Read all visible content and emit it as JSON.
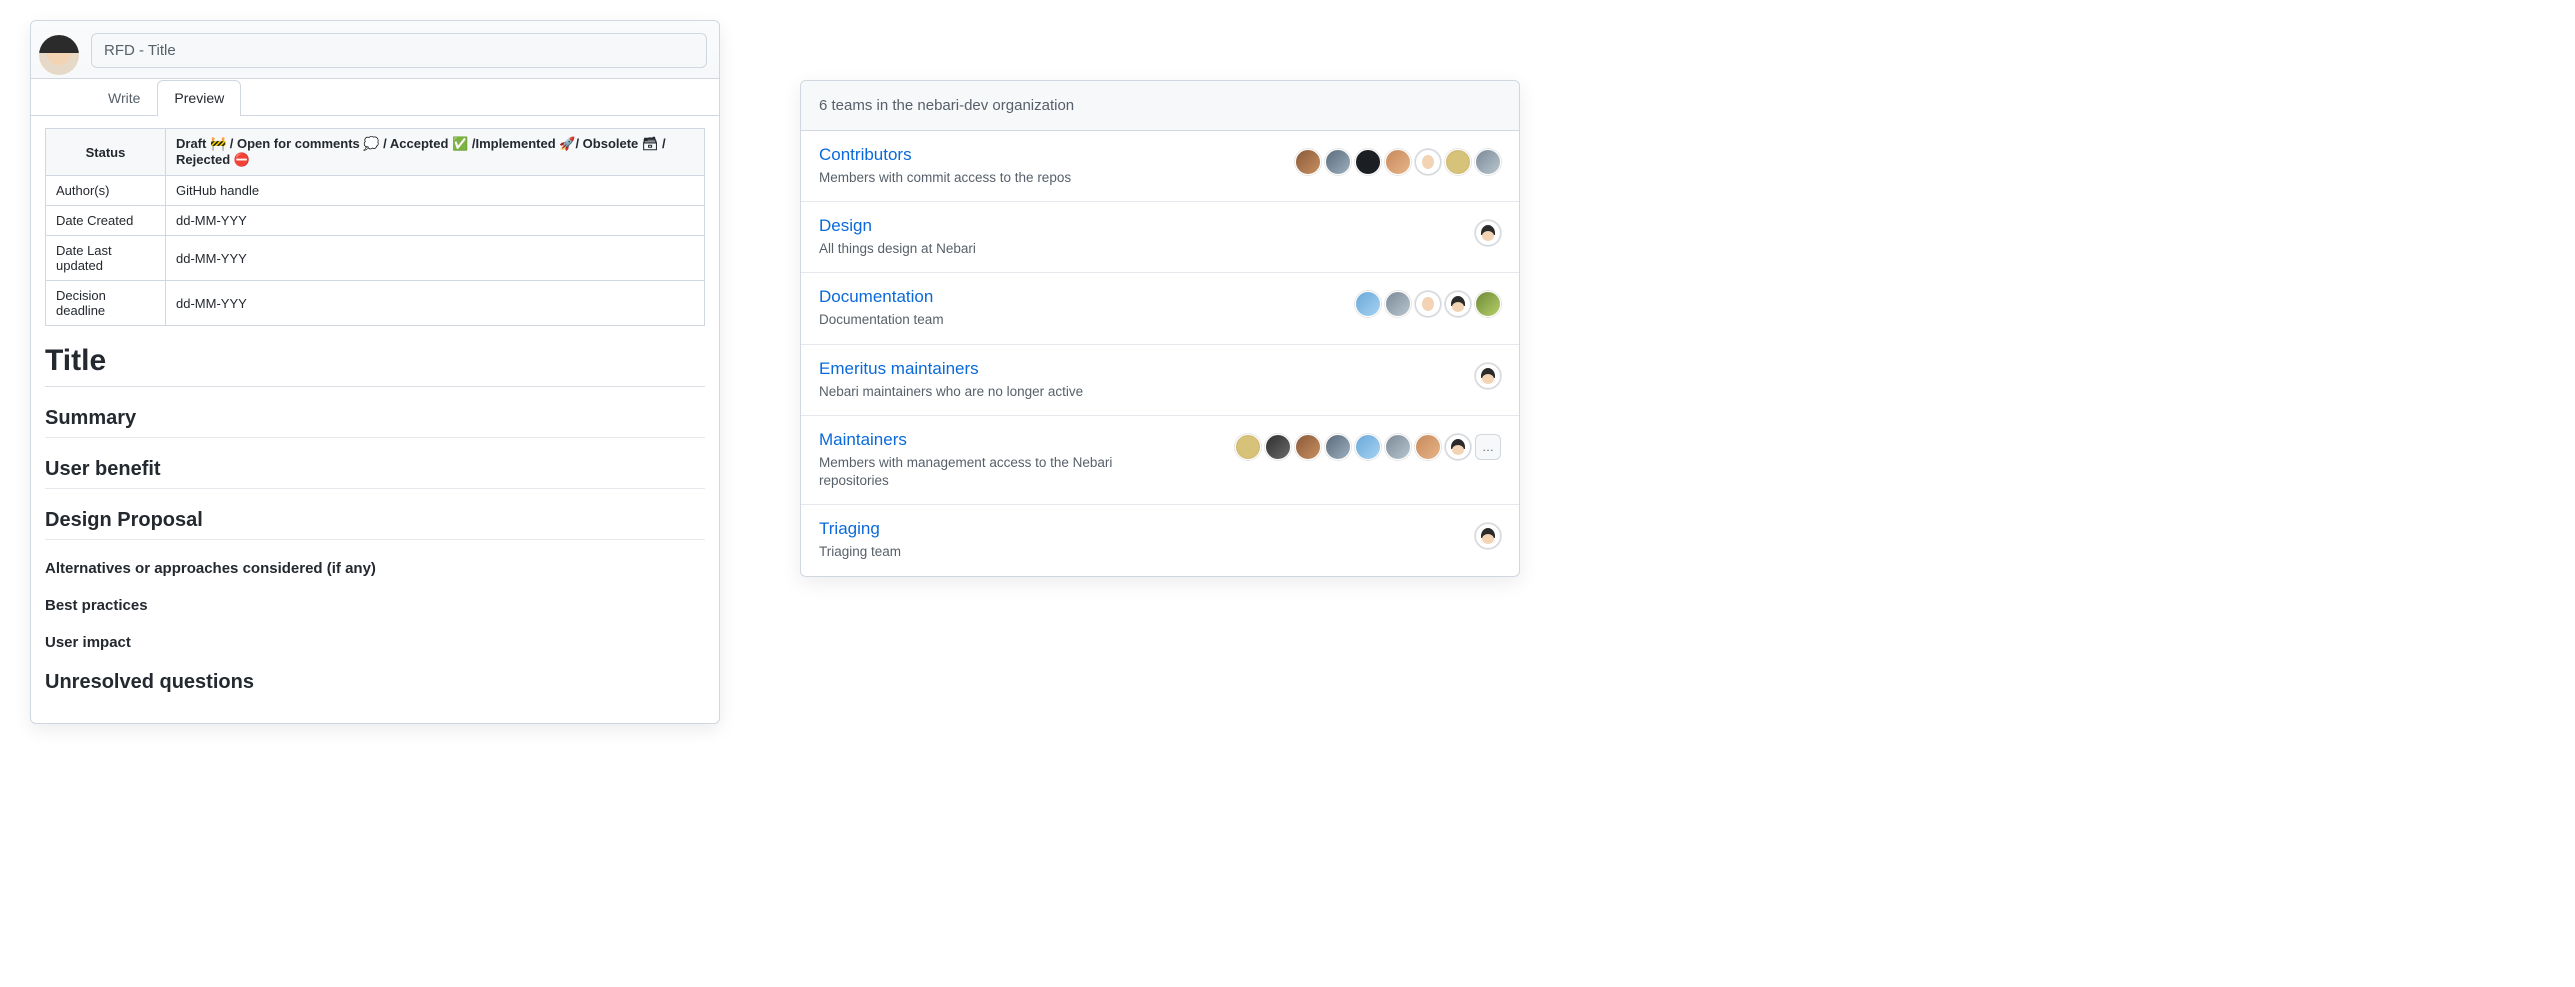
{
  "editor": {
    "title_input_value": "RFD - Title",
    "tabs": {
      "write": "Write",
      "preview": "Preview"
    },
    "meta": {
      "status_label": "Status",
      "status_options": "Draft 🚧 / Open for comments 💭 / Accepted ✅ /Implemented 🚀/ Obsolete 🗃 / Rejected ⛔",
      "author_label": "Author(s)",
      "author_value": "GitHub handle",
      "created_label": "Date Created",
      "created_value": "dd-MM-YYY",
      "updated_label": "Date Last updated",
      "updated_value": "dd-MM-YYY",
      "deadline_label": "Decision deadline",
      "deadline_value": "dd-MM-YYY"
    },
    "headings": {
      "title": "Title",
      "summary": "Summary",
      "user_benefit": "User benefit",
      "design_proposal": "Design Proposal",
      "alternatives": "Alternatives or approaches considered (if any)",
      "best_practices": "Best practices",
      "user_impact": "User impact",
      "unresolved": "Unresolved questions"
    }
  },
  "teams_panel": {
    "header": "6 teams in the nebari-dev organization",
    "more_label": "…",
    "teams": [
      {
        "name": "Contributors",
        "desc": "Members with commit access to the repos",
        "avatars": [
          "av1",
          "av2",
          "av3",
          "av4",
          "av5",
          "av6",
          "av7"
        ],
        "more": false
      },
      {
        "name": "Design",
        "desc": "All things design at Nebari",
        "avatars": [
          "av-cartoon"
        ],
        "more": false
      },
      {
        "name": "Documentation",
        "desc": "Documentation team",
        "avatars": [
          "av8",
          "av7",
          "av5",
          "av-cartoon",
          "av10"
        ],
        "more": false
      },
      {
        "name": "Emeritus maintainers",
        "desc": "Nebari maintainers who are no longer active",
        "avatars": [
          "av-cartoon"
        ],
        "more": false
      },
      {
        "name": "Maintainers",
        "desc": "Members with management access to the Nebari repositories",
        "avatars": [
          "av6",
          "av9",
          "av1",
          "av2",
          "av8",
          "av7",
          "av4",
          "av-cartoon"
        ],
        "more": true
      },
      {
        "name": "Triaging",
        "desc": "Triaging team",
        "avatars": [
          "av-cartoon"
        ],
        "more": false
      }
    ]
  }
}
